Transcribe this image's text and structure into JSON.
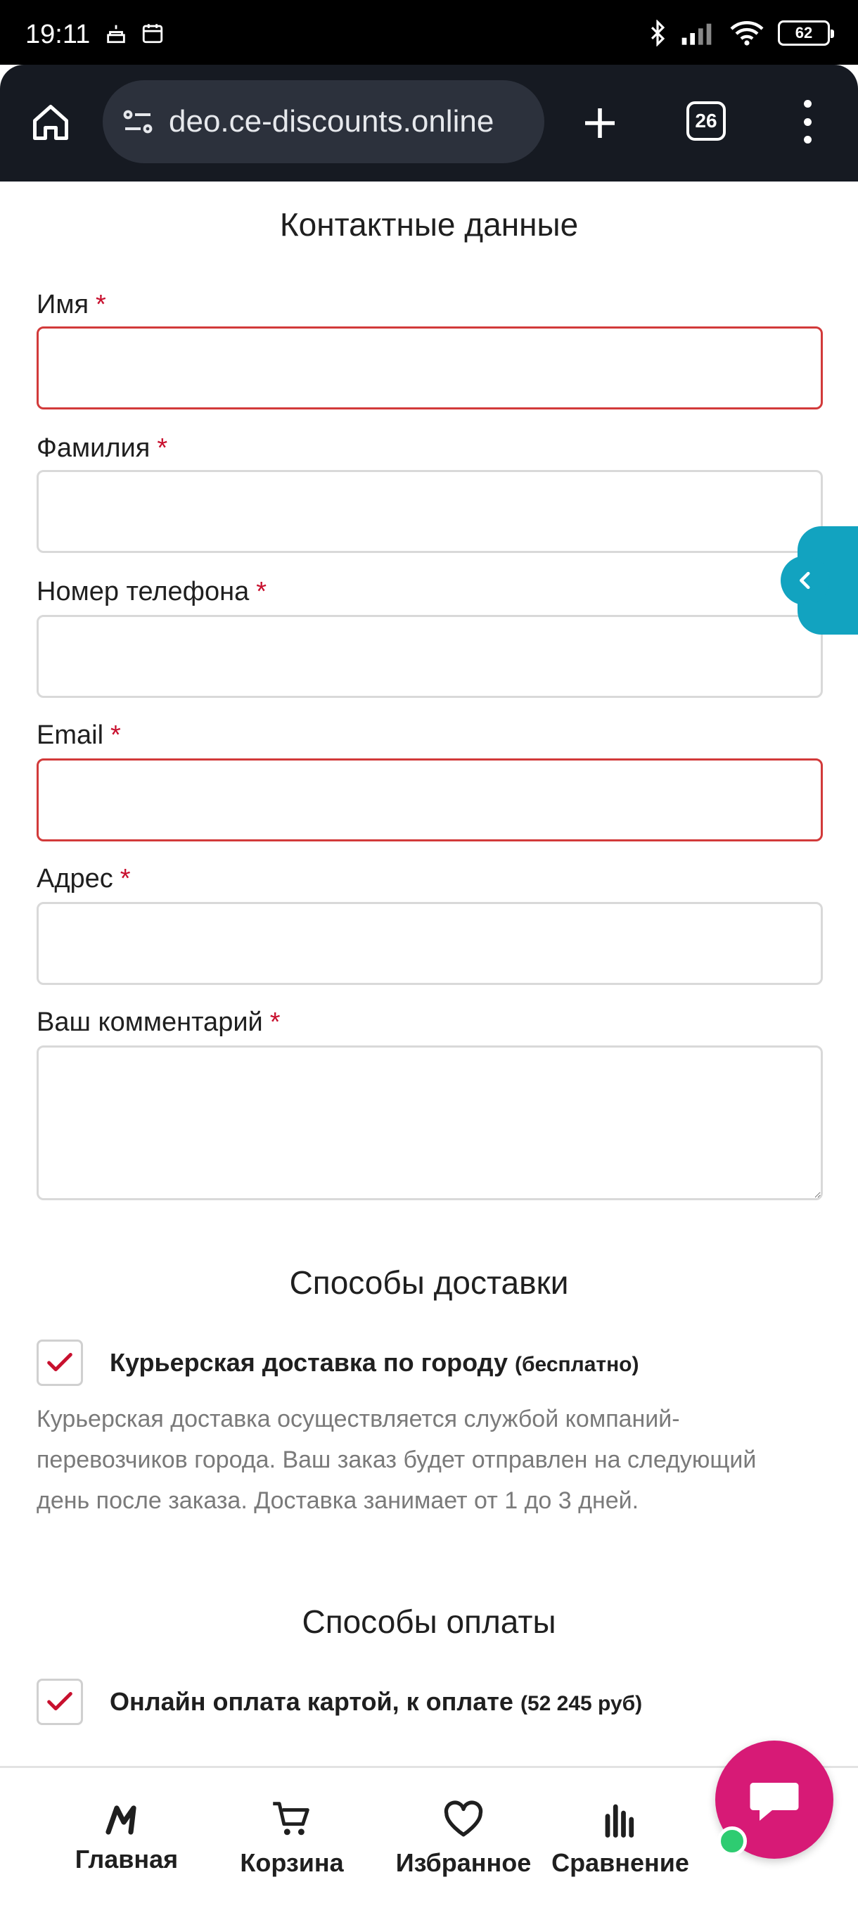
{
  "status_bar": {
    "time": "19:11",
    "battery": "62"
  },
  "browser": {
    "url": "deo.ce-discounts.online",
    "tab_count": "26"
  },
  "contacts": {
    "title": "Контактные данные",
    "required_mark": "*",
    "fields": [
      {
        "label": "Имя"
      },
      {
        "label": "Фамилия"
      },
      {
        "label": "Номер телефона"
      },
      {
        "label": "Email"
      },
      {
        "label": "Адрес"
      },
      {
        "label": "Ваш комментарий"
      }
    ]
  },
  "delivery": {
    "title": "Способы доставки",
    "option_label": "Курьерская доставка по городу",
    "option_note": "(бесплатно)",
    "description": "Курьерская доставка осуществляется службой компаний-перевозчиков города. Ваш заказ будет отправлен на следующий день после заказа. Доставка занимает от 1 до 3 дней."
  },
  "payment": {
    "title": "Способы оплаты",
    "option_label": "Онлайн оплата картой, к оплате",
    "option_note": "(52 245 руб)"
  },
  "bottom_nav": {
    "items": [
      {
        "label": "Главная",
        "icon": "logo-m-icon"
      },
      {
        "label": "Корзина",
        "icon": "cart-icon"
      },
      {
        "label": "Избранное",
        "icon": "heart-icon"
      },
      {
        "label": "Сравнение",
        "icon": "bar-chart-icon"
      }
    ]
  },
  "colors": {
    "accent": "#d71a76",
    "error_border": "#d23a3a",
    "side_handle": "#12a3c0",
    "required": "#c8102e"
  }
}
